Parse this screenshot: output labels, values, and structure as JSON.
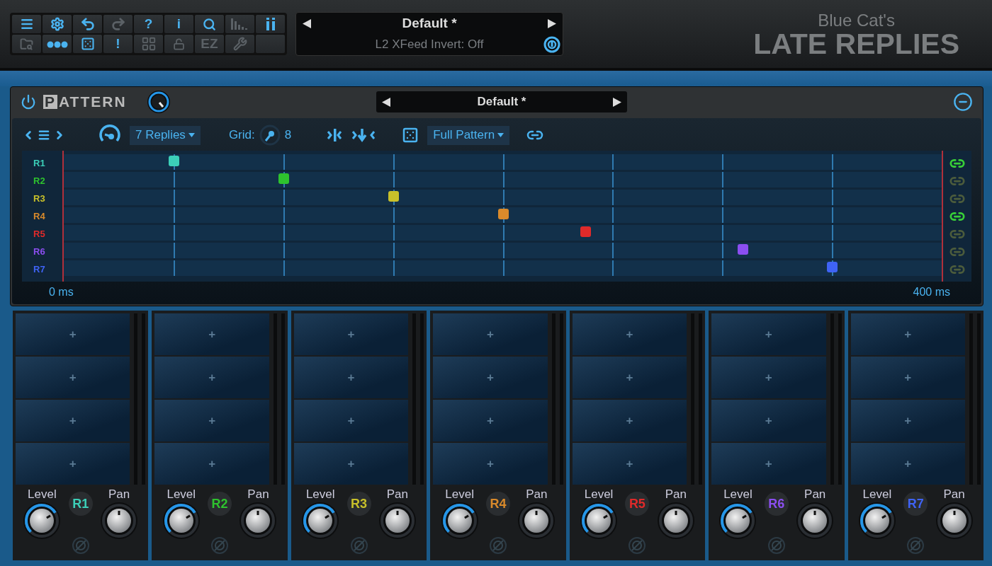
{
  "toolbar": [
    {
      "kind": "icon",
      "disabled": false
    },
    {
      "kind": "icon",
      "disabled": false
    },
    {
      "kind": "icon",
      "disabled": false
    },
    {
      "kind": "icon",
      "disabled": true
    },
    {
      "kind": "text",
      "label": "?",
      "disabled": false
    },
    {
      "kind": "text",
      "label": "i",
      "disabled": false
    },
    {
      "kind": "icon",
      "disabled": false
    },
    {
      "kind": "icon",
      "disabled": true
    },
    {
      "kind": "icon",
      "disabled": false
    },
    {
      "kind": "icon",
      "disabled": true
    },
    {
      "kind": "icon",
      "disabled": false
    },
    {
      "kind": "icon",
      "disabled": false
    },
    {
      "kind": "text",
      "label": "!",
      "disabled": false
    },
    {
      "kind": "icon",
      "disabled": true
    },
    {
      "kind": "icon",
      "disabled": true
    },
    {
      "kind": "text",
      "label": "EZ",
      "disabled": true
    },
    {
      "kind": "icon",
      "disabled": true
    },
    {
      "kind": "blank"
    }
  ],
  "preset": {
    "name": "Default *",
    "parameter": "L2 XFeed Invert: Off"
  },
  "logo": {
    "brand": "Blue Cat's",
    "product": "LATE REPLIES"
  },
  "pattern": {
    "initial": "P",
    "title": "ATTERN",
    "on": true,
    "preset": "Default *",
    "replies": "7 Replies",
    "grid_label": "Grid:",
    "grid_value": "8",
    "mode": "Full Pattern",
    "start": "0 ms",
    "end": "400 ms",
    "rows": [
      {
        "label": "R1",
        "color": "#3ccfb8",
        "level": 0.125,
        "linked": true
      },
      {
        "label": "R2",
        "color": "#2ec22e",
        "level": 0.25,
        "linked": false
      },
      {
        "label": "R3",
        "color": "#c8c02a",
        "level": 0.375,
        "linked": false
      },
      {
        "label": "R4",
        "color": "#d98a2b",
        "level": 0.5,
        "linked": true
      },
      {
        "label": "R5",
        "color": "#e02a2a",
        "level": 0.594,
        "linked": false
      },
      {
        "label": "R6",
        "color": "#8b4ef0",
        "level": 0.773,
        "linked": false
      },
      {
        "label": "R7",
        "color": "#3f63f5",
        "level": 0.875,
        "linked": false
      }
    ]
  },
  "channels": [
    {
      "label": "R1",
      "color": "#3ccfb8",
      "level_label": "Level",
      "pan_label": "Pan",
      "level": 0.72,
      "slots": [
        "+",
        "+",
        "+",
        "+"
      ]
    },
    {
      "label": "R2",
      "color": "#2ec22e",
      "level_label": "Level",
      "pan_label": "Pan",
      "level": 0.72,
      "slots": [
        "+",
        "+",
        "+",
        "+"
      ]
    },
    {
      "label": "R3",
      "color": "#c8c02a",
      "level_label": "Level",
      "pan_label": "Pan",
      "level": 0.72,
      "slots": [
        "+",
        "+",
        "+",
        "+"
      ]
    },
    {
      "label": "R4",
      "color": "#d98a2b",
      "level_label": "Level",
      "pan_label": "Pan",
      "level": 0.72,
      "slots": [
        "+",
        "+",
        "+",
        "+"
      ]
    },
    {
      "label": "R5",
      "color": "#e02a2a",
      "level_label": "Level",
      "pan_label": "Pan",
      "level": 0.72,
      "slots": [
        "+",
        "+",
        "+",
        "+"
      ]
    },
    {
      "label": "R6",
      "color": "#8b4ef0",
      "level_label": "Level",
      "pan_label": "Pan",
      "level": 0.72,
      "slots": [
        "+",
        "+",
        "+",
        "+"
      ]
    },
    {
      "label": "R7",
      "color": "#3f63f5",
      "level_label": "Level",
      "pan_label": "Pan",
      "level": 0.72,
      "slots": [
        "+",
        "+",
        "+",
        "+"
      ]
    }
  ]
}
